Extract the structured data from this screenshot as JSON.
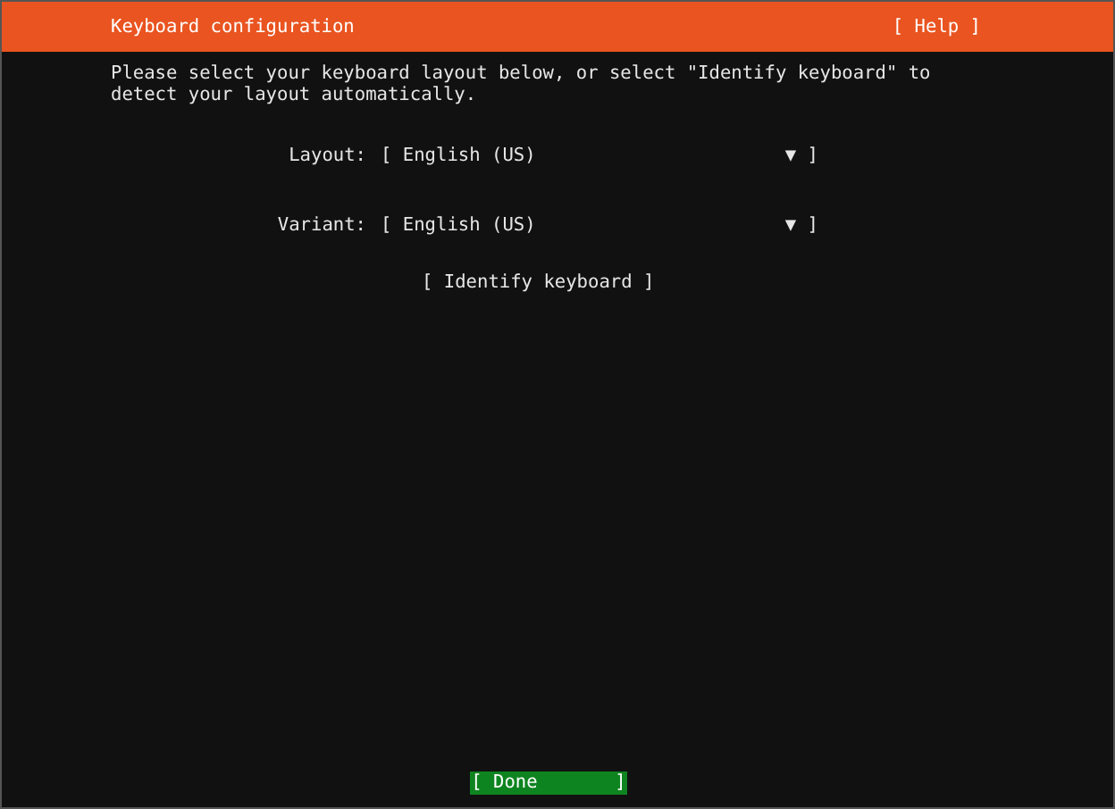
{
  "header": {
    "title": "Keyboard configuration",
    "help": "[ Help ]"
  },
  "instructions": "Please select your keyboard layout below, or select \"Identify keyboard\" to\ndetect your layout automatically.",
  "fields": [
    {
      "label": "Layout:",
      "value": "[ English (US)",
      "arrow": "▼ ]"
    },
    {
      "label": "Variant:",
      "value": "[ English (US)",
      "arrow": "▼ ]"
    }
  ],
  "identify_button": "[ Identify keyboard ]",
  "buttons": [
    {
      "label": "[ Done       ]",
      "selected": true
    }
  ]
}
